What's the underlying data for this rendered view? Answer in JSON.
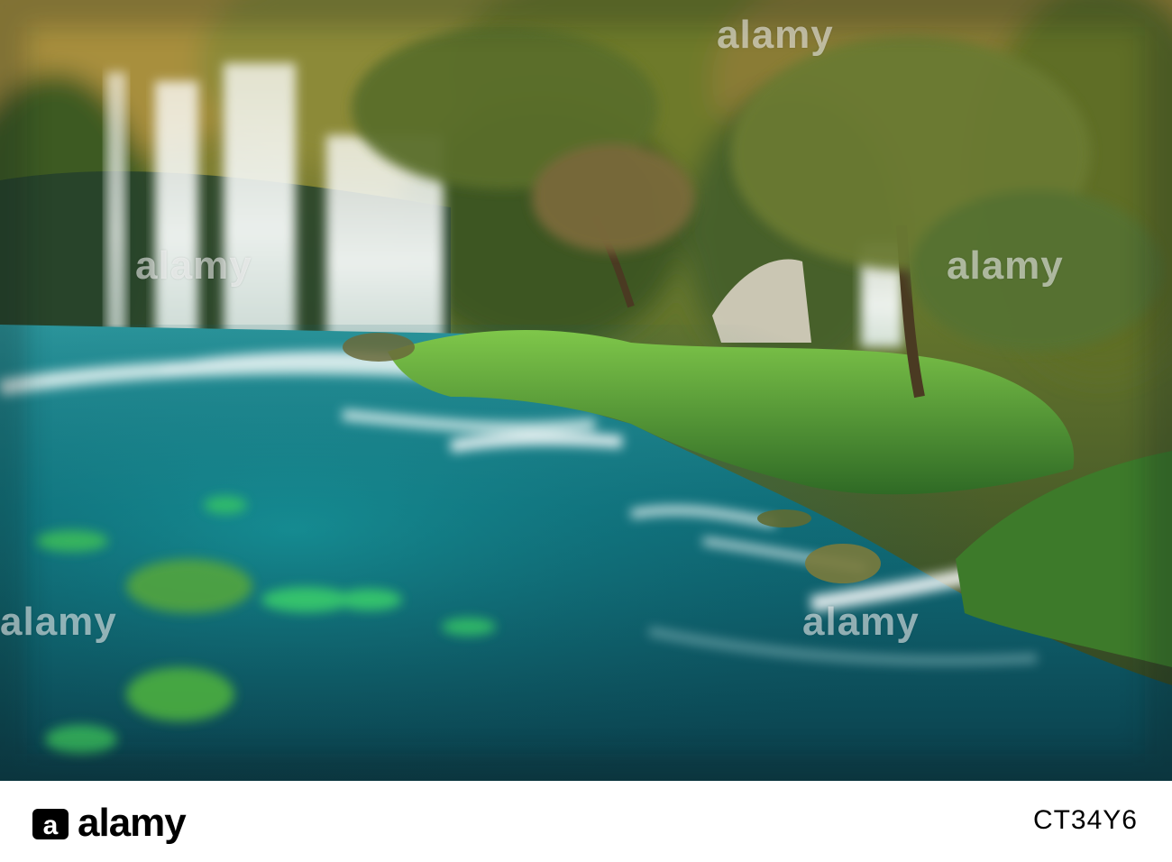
{
  "photo": {
    "subject": "",
    "colors": {
      "water": "#0f6b78",
      "foliage": "#5a7a2a",
      "falls": "#f2f6f4",
      "moss": "#2fd06a"
    }
  },
  "watermark": {
    "text": "alamy"
  },
  "footer": {
    "logo_text": "alamy",
    "image_id": "CT34Y6"
  }
}
